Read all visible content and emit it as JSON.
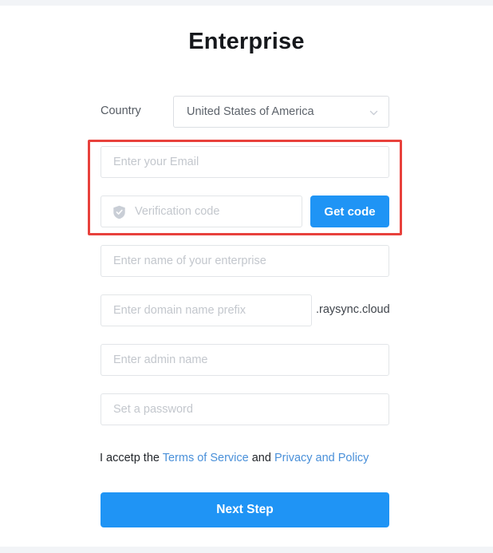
{
  "page": {
    "title": "Enterprise"
  },
  "theme": {
    "primary_blue": "#1f94f5",
    "link_blue": "#4a90d9",
    "highlight_red": "#e8413c",
    "border_gray": "#e2e5e8",
    "placeholder_gray": "#c3c7cd"
  },
  "country": {
    "label": "Country",
    "selected": "United States of America",
    "chevron_icon": "chevron-down-icon"
  },
  "fields": {
    "email": {
      "placeholder": "Enter your Email",
      "value": ""
    },
    "verification_code": {
      "placeholder": "Verification code",
      "value": "",
      "icon": "shield-icon"
    },
    "enterprise_name": {
      "placeholder": "Enter name of your enterprise",
      "value": ""
    },
    "domain_prefix": {
      "placeholder": "Enter domain name prefix",
      "value": "",
      "suffix": ".raysync.cloud"
    },
    "admin_name": {
      "placeholder": "Enter admin name",
      "value": ""
    },
    "password": {
      "placeholder": "Set a password",
      "value": ""
    }
  },
  "buttons": {
    "get_code": "Get code",
    "next_step": "Next Step"
  },
  "terms": {
    "prefix": "I accetp the ",
    "terms_link": "Terms of Service",
    "separator": " and ",
    "privacy_link": "Privacy and Policy"
  }
}
